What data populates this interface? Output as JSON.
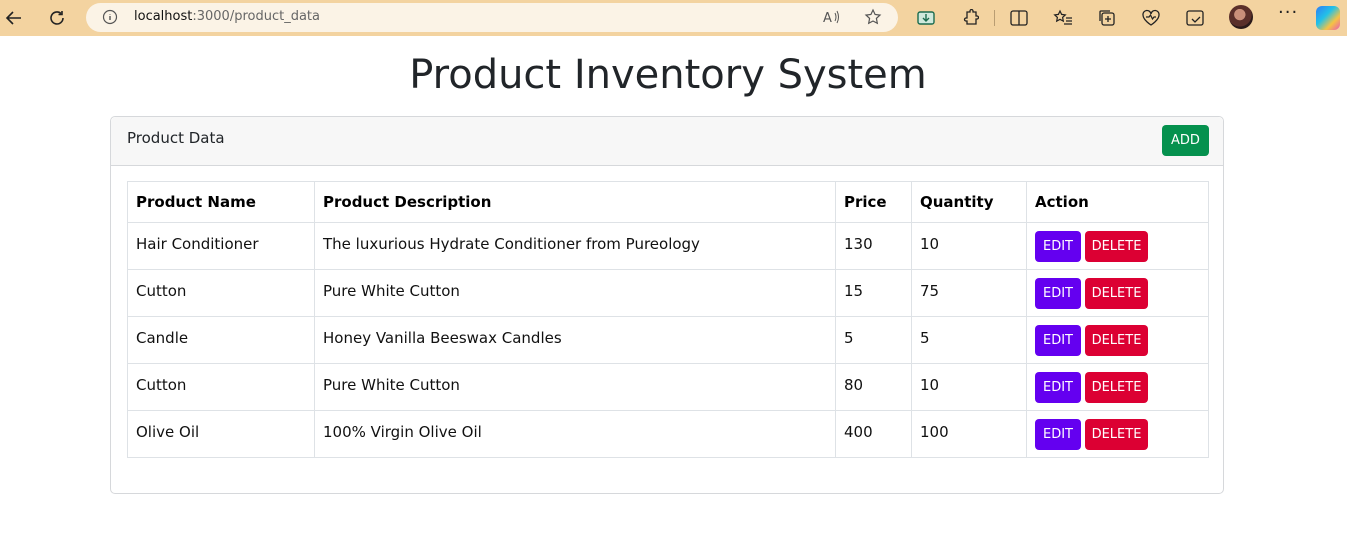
{
  "browser": {
    "url_host": "localhost",
    "url_path": ":3000/product_data"
  },
  "page": {
    "title": "Product Inventory System"
  },
  "card": {
    "header_label": "Product Data",
    "add_label": "ADD"
  },
  "table": {
    "headers": [
      "Product Name",
      "Product Description",
      "Price",
      "Quantity",
      "Action"
    ],
    "rows": [
      {
        "name": "Hair Conditioner",
        "description": "The luxurious Hydrate Conditioner from Pureology",
        "price": "130",
        "quantity": "10"
      },
      {
        "name": "Cutton",
        "description": "Pure White Cutton",
        "price": "15",
        "quantity": "75"
      },
      {
        "name": "Candle",
        "description": "Honey Vanilla Beeswax Candles",
        "price": "5",
        "quantity": "5"
      },
      {
        "name": "Cutton",
        "description": "Pure White Cutton",
        "price": "80",
        "quantity": "10"
      },
      {
        "name": "Olive Oil",
        "description": "100% Virgin Olive Oil",
        "price": "400",
        "quantity": "100"
      }
    ],
    "edit_label": "EDIT",
    "delete_label": "DELETE"
  },
  "colors": {
    "add": "#05914e",
    "edit": "#6400f0",
    "delete": "#dc0033"
  }
}
